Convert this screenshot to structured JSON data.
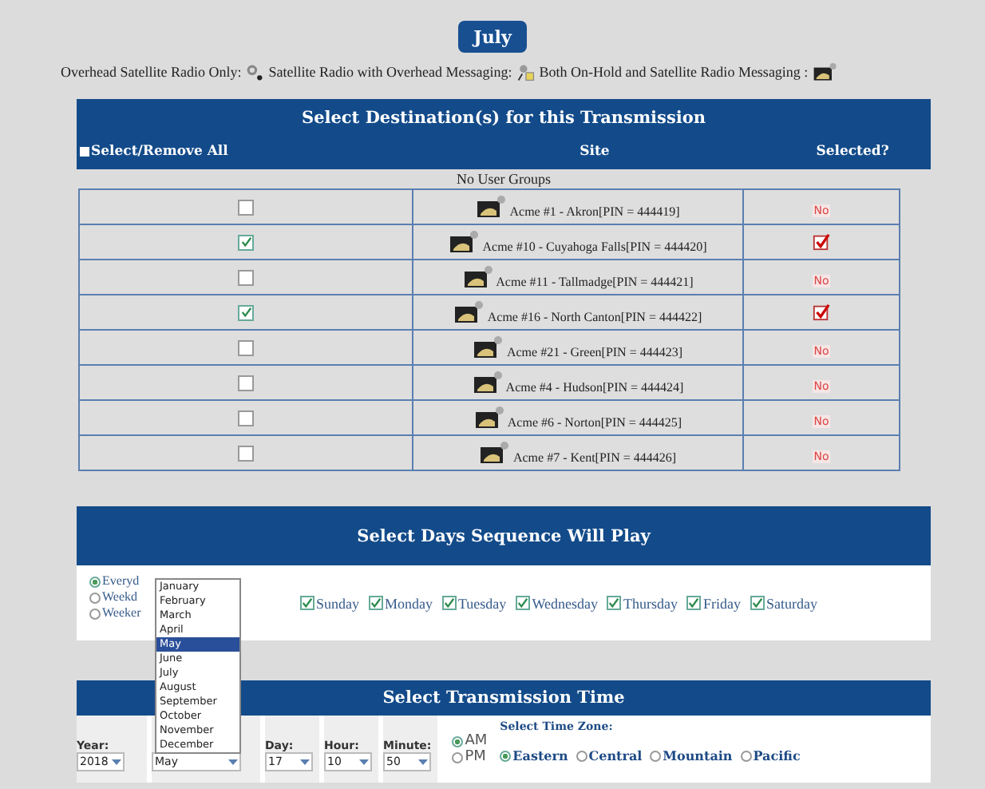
{
  "month_button": "July",
  "legend": [
    {
      "label": "Overhead Satellite Radio Only:",
      "kind": "overhead"
    },
    {
      "label": "Satellite Radio with Overhead Messaging:",
      "kind": "satellite"
    },
    {
      "label": "Both On-Hold and Satellite Radio Messaging :",
      "kind": "both"
    }
  ],
  "destinations": {
    "title": "Select Destination(s) for this Transmission",
    "select_all": {
      "label": "Select/Remove All",
      "checked": false
    },
    "columns": [
      "Site",
      "Selected?"
    ],
    "group_note": "No User Groups",
    "rows": [
      {
        "checked": false,
        "site": "Acme #1 - Akron[PIN = 444419]",
        "status": "No"
      },
      {
        "checked": true,
        "site": "Acme #10 - Cuyahoga Falls[PIN = 444420]"
      },
      {
        "checked": false,
        "site": "Acme #11 - Tallmadge[PIN = 444421]",
        "status": "No"
      },
      {
        "checked": true,
        "site": "Acme #16 - North Canton[PIN = 444422]"
      },
      {
        "checked": false,
        "site": "Acme #21 - Green[PIN = 444423]",
        "status": "No"
      },
      {
        "checked": false,
        "site": "Acme #4 - Hudson[PIN = 444424]",
        "status": "No"
      },
      {
        "checked": false,
        "site": "Acme #6 - Norton[PIN = 444425]",
        "status": "No"
      },
      {
        "checked": false,
        "site": "Acme #7 - Kent[PIN = 444426]",
        "status": "No"
      }
    ]
  },
  "days": {
    "title": "Select Days Sequence Will Play",
    "modes": [
      {
        "label": "Everyd",
        "selected": true
      },
      {
        "label": "Weekd",
        "selected": false
      },
      {
        "label": "Weeker",
        "selected": false
      }
    ],
    "weekdays": [
      {
        "label": "Sunday",
        "checked": true
      },
      {
        "label": "Monday",
        "checked": true
      },
      {
        "label": "Tuesday",
        "checked": true
      },
      {
        "label": "Wednesday",
        "checked": true
      },
      {
        "label": "Thursday",
        "checked": true
      },
      {
        "label": "Friday",
        "checked": true
      },
      {
        "label": "Saturday",
        "checked": true
      }
    ]
  },
  "time": {
    "title": "Select Transmission Time",
    "year": {
      "label": "Year:",
      "value": "2018"
    },
    "month": {
      "value": "May",
      "options": [
        {
          "label": "January",
          "selected": false
        },
        {
          "label": "February",
          "selected": false
        },
        {
          "label": "March",
          "selected": false
        },
        {
          "label": "April",
          "selected": false
        },
        {
          "label": "May",
          "selected": true
        },
        {
          "label": "June",
          "selected": false
        },
        {
          "label": "July",
          "selected": false
        },
        {
          "label": "August",
          "selected": false
        },
        {
          "label": "September",
          "selected": false
        },
        {
          "label": "October",
          "selected": false
        },
        {
          "label": "November",
          "selected": false
        },
        {
          "label": "December",
          "selected": false
        }
      ]
    },
    "day": {
      "label": "Day:",
      "value": "17"
    },
    "hour": {
      "label": "Hour:",
      "value": "10"
    },
    "minute": {
      "label": "Minute:",
      "value": "50"
    },
    "meridiem": [
      {
        "label": "AM",
        "selected": true
      },
      {
        "label": "PM",
        "selected": false
      }
    ],
    "zone_label": "Select Time Zone:",
    "zones": [
      {
        "label": "Eastern",
        "selected": true
      },
      {
        "label": "Central",
        "selected": false
      },
      {
        "label": "Mountain",
        "selected": false
      },
      {
        "label": "Pacific",
        "selected": false
      }
    ]
  }
}
